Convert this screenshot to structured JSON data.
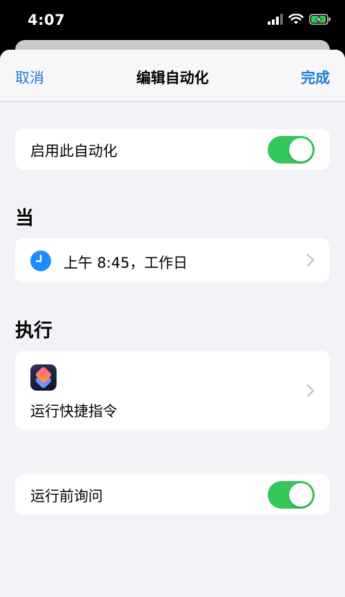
{
  "status_bar": {
    "time": "4:07"
  },
  "nav": {
    "cancel_label": "取消",
    "title": "编辑自动化",
    "done_label": "完成"
  },
  "enable_automation": {
    "label": "启用此自动化",
    "on": true
  },
  "trigger_section": {
    "header": "当",
    "item_label": "上午 8:45，工作日"
  },
  "action_section": {
    "header": "执行",
    "item_label": "运行快捷指令"
  },
  "ask_before_running": {
    "label": "运行前询问",
    "on": true
  },
  "colors": {
    "accent_blue": "#1b7bd8",
    "toggle_green": "#34c759",
    "background": "#f2f2f7"
  },
  "icons": {
    "trigger": "clock-icon",
    "action": "shortcuts-app-icon",
    "row_disclosure": "chevron-right-icon"
  }
}
